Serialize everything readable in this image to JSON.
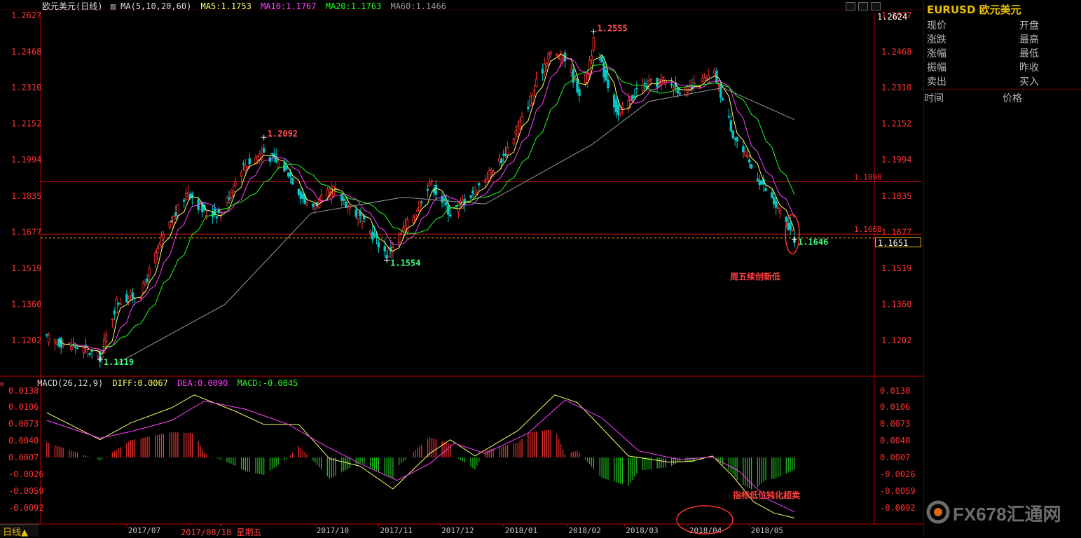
{
  "window": {
    "title": "欧元美元(日线)",
    "ma_indicator": "MA(5,10,20,60)",
    "ma5": "MA5:1.1753",
    "ma10": "MA10:1.1767",
    "ma20": "MA20:1.1763",
    "ma60": "MA60:1.1466",
    "macd_label": "MACD(26,12,9)",
    "diff": "DIFF:0.0067",
    "dea": "DEA:0.0090",
    "macd": "MACD:-0.0045",
    "bottom_tab": "日线▲",
    "last_price_box": "1.1651",
    "top_right_price": "1.2624",
    "cursor_date": "2017/08/18 星期五"
  },
  "side_panel": {
    "title": "EURUSD 欧元美元",
    "rows": [
      {
        "left": "现价",
        "right": "开盘"
      },
      {
        "left": "涨跌",
        "right": "最高"
      },
      {
        "left": "涨幅",
        "right": "最低"
      },
      {
        "left": "振幅",
        "right": "昨收"
      },
      {
        "left": "卖出",
        "right": "买入"
      }
    ],
    "table_header": {
      "time": "时间",
      "price": "价格"
    }
  },
  "annotations": {
    "friday_note": "周五续创新低",
    "indicator_note": "指标低位钝化超卖"
  },
  "logo": {
    "text": "FX678汇通网"
  },
  "colors": {
    "up": "#ff3232",
    "down": "#00c8c8",
    "ma5": "#ffff66",
    "ma10": "#ff40ff",
    "ma20": "#20ff20",
    "ma60": "#9a9a9a",
    "axis": "#ff3030",
    "grid_line": "#c00000",
    "diff": "#ffff66",
    "dea": "#ff40ff",
    "macd_pos": "#ff3232",
    "macd_neg": "#20c820"
  },
  "chart_data": [
    {
      "type": "candlestick",
      "title": "欧元美元(日线)",
      "ylim": [
        1.1119,
        1.2627
      ],
      "y_ticks": [
        "1.2627",
        "1.2468",
        "1.2310",
        "1.2152",
        "1.1994",
        "1.1835",
        "1.1677",
        "1.1519",
        "1.1360",
        "1.1202"
      ],
      "x_ticks": [
        "2017/07",
        "2017/08",
        "2017/10",
        "2017/11",
        "2017/12",
        "2018/01",
        "2018/02",
        "2018/03",
        "2018/04",
        "2018/05"
      ],
      "price_labels": [
        {
          "label": "1.1119",
          "value": 1.1119,
          "kind": "low"
        },
        {
          "label": "1.2092",
          "value": 1.2092,
          "kind": "high"
        },
        {
          "label": "1.1554",
          "value": 1.1554,
          "kind": "low"
        },
        {
          "label": "1.2555",
          "value": 1.2555,
          "kind": "high"
        },
        {
          "label": "1.1646",
          "value": 1.1646,
          "kind": "low"
        }
      ],
      "horizontal_lines": [
        {
          "label": "1.1898",
          "value": 1.1898
        },
        {
          "label": "1.1668",
          "value": 1.1668
        }
      ],
      "last_price": 1.1651,
      "close_path": [
        {
          "x": "2017/05/25",
          "y": 1.121
        },
        {
          "x": "2017/06/10",
          "y": 1.117
        },
        {
          "x": "2017/06/20",
          "y": 1.113
        },
        {
          "x": "2017/06/28",
          "y": 1.137
        },
        {
          "x": "2017/07/10",
          "y": 1.141
        },
        {
          "x": "2017/07/20",
          "y": 1.164
        },
        {
          "x": "2017/08/02",
          "y": 1.186
        },
        {
          "x": "2017/08/10",
          "y": 1.176
        },
        {
          "x": "2017/08/18",
          "y": 1.176
        },
        {
          "x": "2017/08/28",
          "y": 1.196
        },
        {
          "x": "2017/09/08",
          "y": 1.203
        },
        {
          "x": "2017/09/20",
          "y": 1.194
        },
        {
          "x": "2017/09/30",
          "y": 1.178
        },
        {
          "x": "2017/10/12",
          "y": 1.186
        },
        {
          "x": "2017/10/25",
          "y": 1.174
        },
        {
          "x": "2017/11/07",
          "y": 1.158
        },
        {
          "x": "2017/11/20",
          "y": 1.175
        },
        {
          "x": "2017/11/28",
          "y": 1.19
        },
        {
          "x": "2017/12/08",
          "y": 1.176
        },
        {
          "x": "2017/12/20",
          "y": 1.186
        },
        {
          "x": "2018/01/03",
          "y": 1.201
        },
        {
          "x": "2018/01/12",
          "y": 1.217
        },
        {
          "x": "2018/01/25",
          "y": 1.246
        },
        {
          "x": "2018/02/02",
          "y": 1.244
        },
        {
          "x": "2018/02/10",
          "y": 1.227
        },
        {
          "x": "2018/02/16",
          "y": 1.251
        },
        {
          "x": "2018/02/28",
          "y": 1.219
        },
        {
          "x": "2018/03/10",
          "y": 1.231
        },
        {
          "x": "2018/03/22",
          "y": 1.234
        },
        {
          "x": "2018/04/02",
          "y": 1.229
        },
        {
          "x": "2018/04/16",
          "y": 1.237
        },
        {
          "x": "2018/04/25",
          "y": 1.211
        },
        {
          "x": "2018/05/04",
          "y": 1.196
        },
        {
          "x": "2018/05/14",
          "y": 1.182
        },
        {
          "x": "2018/05/25",
          "y": 1.165
        }
      ],
      "ma60_path": [
        {
          "x": "2017/06/28",
          "y": 1.11
        },
        {
          "x": "2017/08/20",
          "y": 1.136
        },
        {
          "x": "2017/10/01",
          "y": 1.176
        },
        {
          "x": "2017/11/15",
          "y": 1.183
        },
        {
          "x": "2017/12/25",
          "y": 1.18
        },
        {
          "x": "2018/02/15",
          "y": 1.206
        },
        {
          "x": "2018/03/15",
          "y": 1.225
        },
        {
          "x": "2018/04/20",
          "y": 1.231
        },
        {
          "x": "2018/05/25",
          "y": 1.217
        }
      ]
    },
    {
      "type": "bar",
      "title": "MACD(26,12,9)",
      "ylim": [
        -0.0115,
        0.0138
      ],
      "y_ticks": [
        "0.0138",
        "0.0106",
        "0.0073",
        "0.0040",
        "0.0007",
        "-0.0026",
        "-0.0059",
        "-0.0092"
      ],
      "series": [
        {
          "name": "DIFF",
          "points": [
            {
              "x": "2017/05/25",
              "y": 0.0095
            },
            {
              "x": "2017/06/20",
              "y": 0.0042
            },
            {
              "x": "2017/07/05",
              "y": 0.0075
            },
            {
              "x": "2017/07/25",
              "y": 0.0105
            },
            {
              "x": "2017/08/05",
              "y": 0.013
            },
            {
              "x": "2017/08/25",
              "y": 0.0098
            },
            {
              "x": "2017/09/08",
              "y": 0.0072
            },
            {
              "x": "2017/09/25",
              "y": 0.0072
            },
            {
              "x": "2017/10/10",
              "y": 0.0005
            },
            {
              "x": "2017/10/25",
              "y": -0.001
            },
            {
              "x": "2017/11/10",
              "y": -0.0055
            },
            {
              "x": "2017/11/28",
              "y": 0.0015
            },
            {
              "x": "2017/12/08",
              "y": 0.0042
            },
            {
              "x": "2017/12/20",
              "y": 0.001
            },
            {
              "x": "2018/01/10",
              "y": 0.006
            },
            {
              "x": "2018/01/28",
              "y": 0.013
            },
            {
              "x": "2018/02/08",
              "y": 0.0115
            },
            {
              "x": "2018/02/20",
              "y": 0.0065
            },
            {
              "x": "2018/03/05",
              "y": 0.001
            },
            {
              "x": "2018/03/25",
              "y": -0.0002
            },
            {
              "x": "2018/04/05",
              "y": 0.0
            },
            {
              "x": "2018/04/15",
              "y": 0.001
            },
            {
              "x": "2018/04/25",
              "y": -0.003
            },
            {
              "x": "2018/05/05",
              "y": -0.008
            },
            {
              "x": "2018/05/15",
              "y": -0.0102
            },
            {
              "x": "2018/05/25",
              "y": -0.0112
            }
          ]
        },
        {
          "name": "DEA",
          "points": [
            {
              "x": "2017/05/25",
              "y": 0.008
            },
            {
              "x": "2017/06/20",
              "y": 0.0045
            },
            {
              "x": "2017/07/05",
              "y": 0.0058
            },
            {
              "x": "2017/07/25",
              "y": 0.008
            },
            {
              "x": "2017/08/10",
              "y": 0.0118
            },
            {
              "x": "2017/08/30",
              "y": 0.0102
            },
            {
              "x": "2017/09/20",
              "y": 0.0072
            },
            {
              "x": "2017/10/08",
              "y": 0.003
            },
            {
              "x": "2017/10/25",
              "y": -0.0005
            },
            {
              "x": "2017/11/12",
              "y": -0.0038
            },
            {
              "x": "2017/11/28",
              "y": -0.0005
            },
            {
              "x": "2017/12/10",
              "y": 0.0035
            },
            {
              "x": "2017/12/25",
              "y": 0.0015
            },
            {
              "x": "2018/01/15",
              "y": 0.0055
            },
            {
              "x": "2018/02/02",
              "y": 0.012
            },
            {
              "x": "2018/02/20",
              "y": 0.0085
            },
            {
              "x": "2018/03/10",
              "y": 0.002
            },
            {
              "x": "2018/03/30",
              "y": 0.0003
            },
            {
              "x": "2018/04/15",
              "y": 0.0008
            },
            {
              "x": "2018/04/28",
              "y": -0.002
            },
            {
              "x": "2018/05/12",
              "y": -0.0075
            },
            {
              "x": "2018/05/25",
              "y": -0.01
            }
          ]
        }
      ]
    }
  ]
}
